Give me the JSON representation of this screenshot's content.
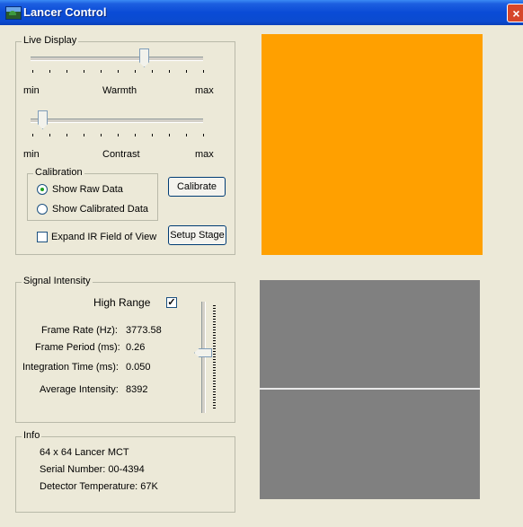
{
  "window": {
    "title": "Lancer Control",
    "close_glyph": "×"
  },
  "live_display": {
    "label": "Live Display",
    "warmth": {
      "min": "min",
      "label": "Warmth",
      "max": "max",
      "level": 0.55
    },
    "contrast": {
      "min": "min",
      "label": "Contrast",
      "max": "max",
      "level": 0.08
    },
    "calibration": {
      "label": "Calibration",
      "raw": "Show Raw Data",
      "calibrated": "Show Calibrated Data",
      "selected": "raw"
    },
    "calibrate_button": "Calibrate",
    "expand_ir": "Expand IR Field of View",
    "expand_ir_checked": false,
    "setup_stage_button": "Setup Stage"
  },
  "signal": {
    "label": "Signal Intensity",
    "high_range_label": "High Range",
    "high_range_checked": true,
    "high_range_glyph": "✓",
    "frame_rate_label": "Frame Rate (Hz):",
    "frame_rate_value": "3773.58",
    "frame_period_label": "Frame Period (ms):",
    "frame_period_value": "0.26",
    "integration_label": "Integration Time (ms):",
    "integration_value": "0.050",
    "average_label": "Average Intensity:",
    "average_value": "8392",
    "slider_level": 0.55
  },
  "info": {
    "label": "Info",
    "model": "64 x 64 Lancer MCT",
    "serial": "Serial Number: 00-4394",
    "temperature": "Detector Temperature:  67K"
  },
  "colors": {
    "image_display": "#FFA000",
    "signal_plot": "#808080",
    "title_bar": "#0A4BD6"
  }
}
